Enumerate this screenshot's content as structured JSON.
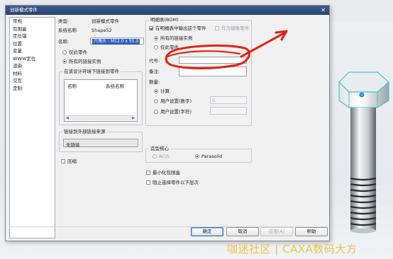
{
  "dialog": {
    "title": "创新模式零件",
    "close_glyph": "✕"
  },
  "nav": {
    "items": [
      "常规",
      "包围盒",
      "定位锚",
      "位置",
      "变量",
      "WWW定位",
      "渲染",
      "材料",
      "交互",
      "定制"
    ]
  },
  "general": {
    "type_label": "类型:",
    "type_value": "创新模式零件",
    "system_name_label": "系统名称",
    "system_name_value": "Shape52",
    "name_label": "名称:",
    "name_value": "六角头 - M12.0 x 55.0"
  },
  "scope": {
    "only_this_part": "仅此零件",
    "all_linked_instances": "所有的链接实例"
  },
  "linked_parts": {
    "title": "在该设计环境下链接到零件",
    "col_name": "名称",
    "col_system_name": "系统名称"
  },
  "link_source": {
    "title": "链接到外部链接来源",
    "value": "无链接"
  },
  "compress_label": "压缩",
  "bom": {
    "title": "明细表(BOM)",
    "show_in_bom_label": "在明细表中输出这个零件",
    "as_mirror_part_label": "作为镜像零件",
    "all_linked_instances": "所有的链接实例",
    "only_this_part": "仅此零件",
    "code_label": "代号:",
    "note_label": "备注:",
    "quantity_label": "数量:",
    "calc_option": "计算",
    "user_number_option": "用户设置(数字)",
    "user_number_value": "0",
    "user_string_option": "用户设置(字符)"
  },
  "kernel": {
    "title": "造型核心",
    "acis": "ACIS",
    "parasolid": "Parasolid"
  },
  "options": {
    "minimize_bbox": "最小化包围盒",
    "block_selection": "阻止选择零件以下层次"
  },
  "buttons": {
    "ok": "确定",
    "cancel": "取消",
    "apply": "应用(A)",
    "help": "帮助"
  },
  "watermark": "咖迷社区 | CAXA数码大方",
  "colors": {
    "titlebar": "#2f4d7c",
    "annotation_red": "#e8220f",
    "selection": "#2b5fbd",
    "model_teal": "#5fd0c8",
    "watermark": "#e8be28"
  }
}
